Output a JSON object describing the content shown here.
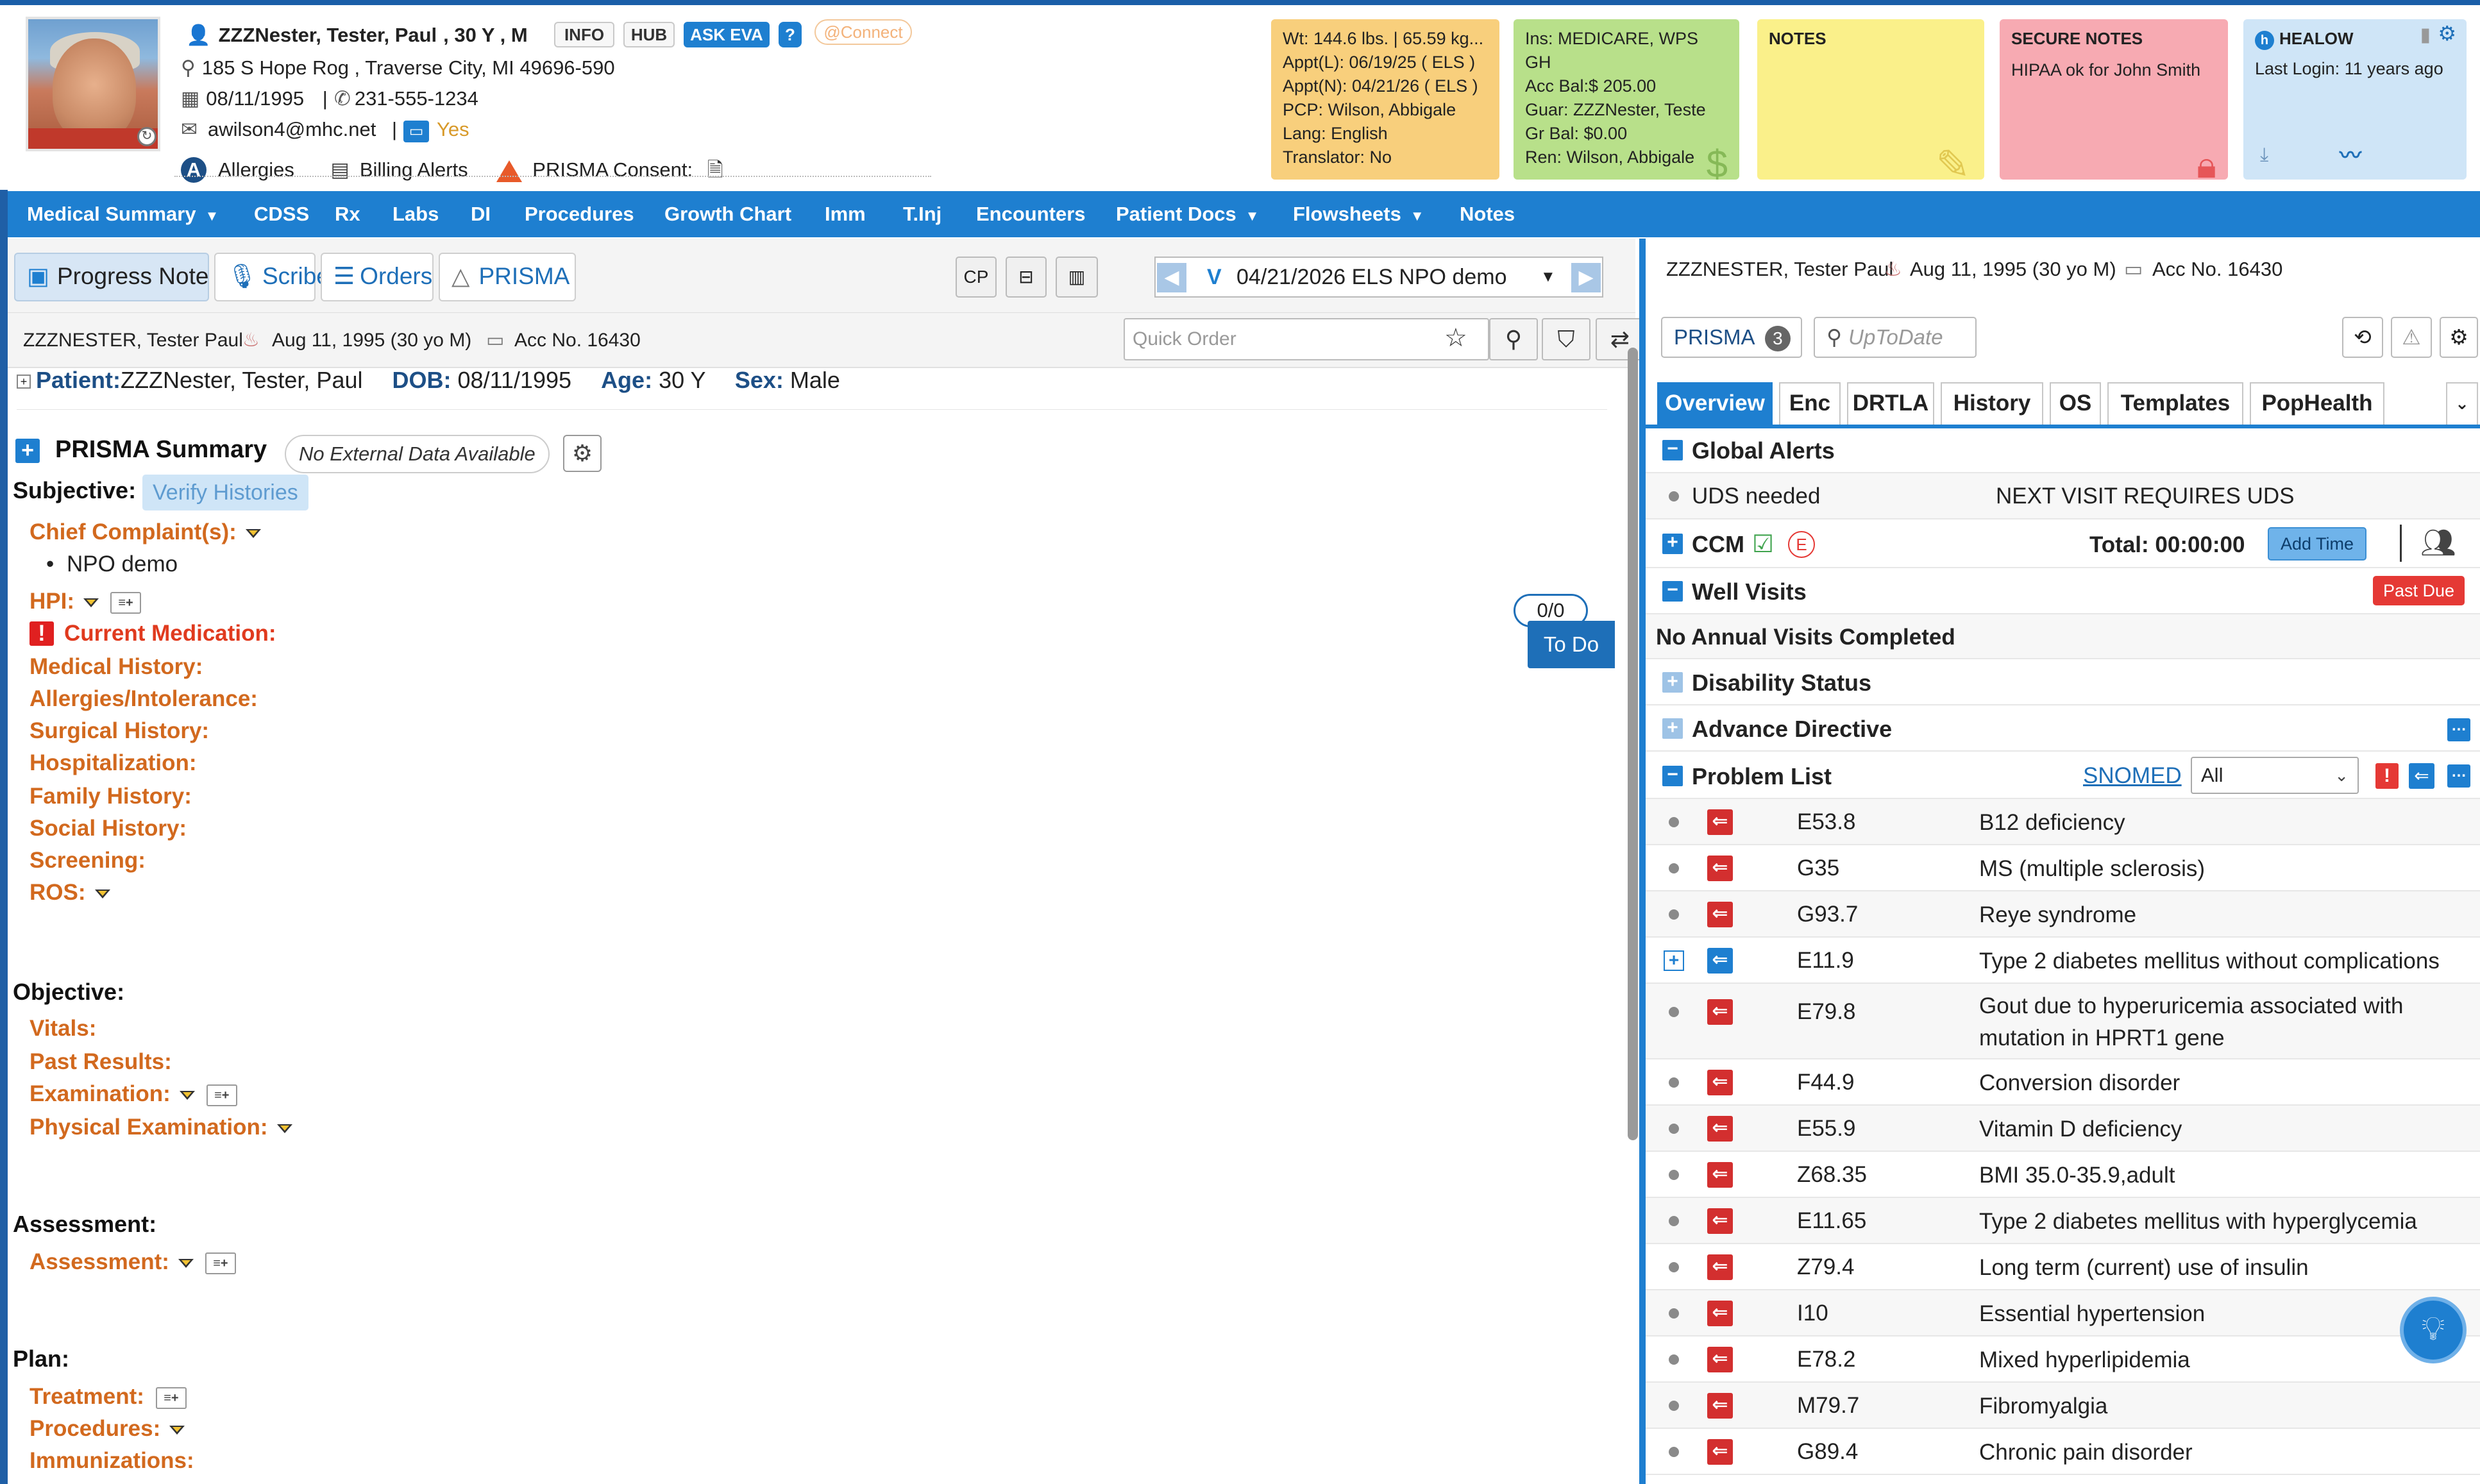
{
  "patient_header": {
    "name_line": "ZZZNester, Tester, Paul",
    "age_sex": ", 30 Y , M",
    "buttons": {
      "info": "INFO",
      "hub": "HUB",
      "ask_eva": "ASK EVA",
      "help": "?",
      "connect": "@Connect"
    },
    "address": "185 S Hope Rog , Traverse City, MI 49696-590",
    "dob": "08/11/1995",
    "phone": "231-555-1234",
    "email": "awilson4@mhc.net",
    "portal_status": "Yes",
    "allergies_label": "Allergies",
    "billing_alerts_label": "Billing Alerts",
    "prisma_consent_label": "PRISMA Consent:"
  },
  "sticky_notes": {
    "vitals": {
      "lines": [
        "Wt: 144.6 lbs. | 65.59 kg...",
        "Appt(L): 06/19/25 ( ELS )",
        "Appt(N): 04/21/26 ( ELS )",
        "PCP: Wilson, Abbigale",
        "Lang: English",
        "Translator: No"
      ]
    },
    "insurance": {
      "lines": [
        "Ins: MEDICARE, WPS GH",
        "Acc Bal:$ 205.00",
        "Guar: ZZZNester, Teste",
        "Gr Bal: $0.00",
        "Ren: Wilson, Abbigale"
      ]
    },
    "notes": {
      "title": "NOTES"
    },
    "secure_notes": {
      "title": "SECURE NOTES",
      "text": "HIPAA ok for John Smith"
    },
    "healow": {
      "title": "HEALOW",
      "text": "Last Login: 11 years ago"
    }
  },
  "nav": {
    "items": [
      "Medical Summary",
      "CDSS",
      "Rx",
      "Labs",
      "DI",
      "Procedures",
      "Growth Chart",
      "Imm",
      "T.Inj",
      "Encounters",
      "Patient Docs",
      "Flowsheets",
      "Notes"
    ]
  },
  "progress_tabs": {
    "progress_note": "Progress Note",
    "scribe": "Scribe",
    "orders": "Orders",
    "prisma": "PRISMA"
  },
  "toolbar": {
    "cp": "CP",
    "encounter_prefix": "V",
    "encounter": "04/21/2026 ELS NPO demo",
    "quick_order_placeholder": "Quick Order"
  },
  "subbar": {
    "name": "ZZZNESTER, Tester Paul",
    "dob": "Aug 11, 1995 (30 yo M)",
    "acc": "Acc No. 16430"
  },
  "patient_line": {
    "patient_label": "Patient:",
    "patient_value": "ZZZNester, Tester, Paul",
    "dob_label": "DOB:",
    "dob_value": "08/11/1995",
    "age_label": "Age:",
    "age_value": "30 Y",
    "sex_label": "Sex:",
    "sex_value": "Male"
  },
  "note": {
    "prisma_summary": "PRISMA Summary",
    "no_external": "No External Data Available",
    "subjective": "Subjective:",
    "verify_histories": "Verify Histories",
    "chief_complaint": "Chief Complaint(s):",
    "complaint_item": "NPO demo",
    "hpi": "HPI:",
    "current_medication": "Current Medication:",
    "medical_history": "Medical History:",
    "allergies": "Allergies/Intolerance:",
    "surgical_history": "Surgical History:",
    "hospitalization": "Hospitalization:",
    "family_history": "Family History:",
    "social_history": "Social History:",
    "screening": "Screening:",
    "ros": "ROS:",
    "objective": "Objective:",
    "vitals": "Vitals:",
    "past_results": "Past Results:",
    "examination": "Examination:",
    "physical_examination": "Physical Examination:",
    "assessment_section": "Assessment:",
    "assessment": "Assessment:",
    "plan": "Plan:",
    "treatment": "Treatment:",
    "procedures": "Procedures:",
    "immunizations": "Immunizations:",
    "todo_count": "0/0",
    "todo_label": "To Do"
  },
  "right_panel": {
    "name": "ZZZNESTER, Tester Paul",
    "dob": "Aug 11, 1995 (30 yo M)",
    "acc": "Acc No. 16430",
    "prisma_label": "PRISMA",
    "prisma_count": "3",
    "uptodate_placeholder": "UpToDate",
    "tabs": [
      "Overview",
      "Enc",
      "DRTLA",
      "History",
      "OS",
      "Templates",
      "PopHealth"
    ],
    "global_alerts": "Global Alerts",
    "uds_label": "UDS needed",
    "uds_value": "NEXT VISIT REQUIRES UDS",
    "ccm": "CCM",
    "ccm_total": "Total: 00:00:00",
    "add_time": "Add Time",
    "well_visits": "Well Visits",
    "past_due": "Past Due",
    "no_annual": "No Annual Visits Completed",
    "disability": "Disability Status",
    "advance_directive": "Advance Directive",
    "problem_list": "Problem List",
    "snomed": "SNOMED",
    "filter_value": "All",
    "problems": [
      {
        "code": "E53.8",
        "desc": "B12 deficiency"
      },
      {
        "code": "G35",
        "desc": "MS (multiple sclerosis)"
      },
      {
        "code": "G93.7",
        "desc": "Reye syndrome"
      },
      {
        "code": "E11.9",
        "desc": "Type 2 diabetes mellitus without complications"
      },
      {
        "code": "E79.8",
        "desc": "Gout due to hyperuricemia associated with mutation in HPRT1 gene"
      },
      {
        "code": "F44.9",
        "desc": "Conversion disorder"
      },
      {
        "code": "E55.9",
        "desc": "Vitamin D deficiency"
      },
      {
        "code": "Z68.35",
        "desc": "BMI 35.0-35.9,adult"
      },
      {
        "code": "E11.65",
        "desc": "Type 2 diabetes mellitus with hyperglycemia"
      },
      {
        "code": "Z79.4",
        "desc": "Long term (current) use of insulin"
      },
      {
        "code": "I10",
        "desc": "Essential hypertension"
      },
      {
        "code": "E78.2",
        "desc": "Mixed hyperlipidemia"
      },
      {
        "code": "M79.7",
        "desc": "Fibromyalgia"
      },
      {
        "code": "G89.4",
        "desc": "Chronic pain disorder"
      }
    ]
  }
}
